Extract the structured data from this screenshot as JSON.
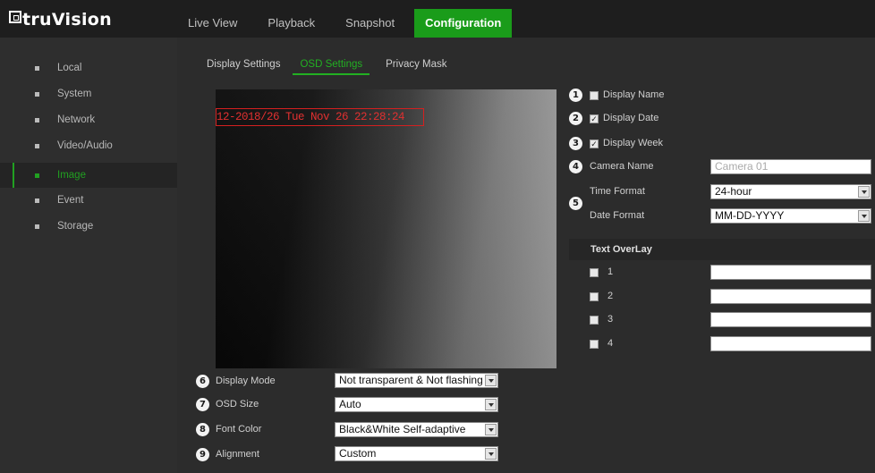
{
  "logo": {
    "text": "truVision"
  },
  "nav": [
    "Live View",
    "Playback",
    "Snapshot",
    "Configuration"
  ],
  "nav_active": "Configuration",
  "sidebar": [
    "Local",
    "System",
    "Network",
    "Video/Audio",
    "Image",
    "Event",
    "Storage"
  ],
  "sidebar_active": "Image",
  "subtabs": [
    "Display Settings",
    "OSD Settings",
    "Privacy Mask"
  ],
  "subtab_active": "OSD Settings",
  "preview": {
    "osd_text": "12-2018/26 Tue Nov 26 22:28:24"
  },
  "osd": {
    "display_name": {
      "badge": "1",
      "label": "Display Name",
      "checked": false
    },
    "display_date": {
      "badge": "2",
      "label": "Display Date",
      "checked": true
    },
    "display_week": {
      "badge": "3",
      "label": "Display Week",
      "checked": true
    },
    "camera_name": {
      "badge": "4",
      "label": "Camera Name",
      "placeholder": "Camera 01"
    },
    "time_format": {
      "label": "Time Format",
      "value": "24-hour"
    },
    "date_format": {
      "label": "Date Format",
      "value": "MM-DD-YYYY"
    },
    "format_badge": "5"
  },
  "text_overlay": {
    "title": "Text OverLay",
    "rows": [
      {
        "label": "1",
        "value": ""
      },
      {
        "label": "2",
        "value": ""
      },
      {
        "label": "3",
        "value": ""
      },
      {
        "label": "4",
        "value": ""
      }
    ]
  },
  "bottom": {
    "display_mode": {
      "badge": "6",
      "label": "Display Mode",
      "value": "Not transparent & Not flashing"
    },
    "osd_size": {
      "badge": "7",
      "label": "OSD Size",
      "value": "Auto"
    },
    "font_color": {
      "badge": "8",
      "label": "Font Color",
      "value": "Black&White Self-adaptive"
    },
    "alignment": {
      "badge": "9",
      "label": "Alignment",
      "value": "Custom"
    }
  },
  "colors": {
    "accent": "#1a9c1a",
    "osd_red": "#d42020"
  },
  "icons": {
    "checkbox": "checkbox-icon",
    "dropdown": "chevron-down-icon",
    "bullet": "square-bullet-icon"
  }
}
